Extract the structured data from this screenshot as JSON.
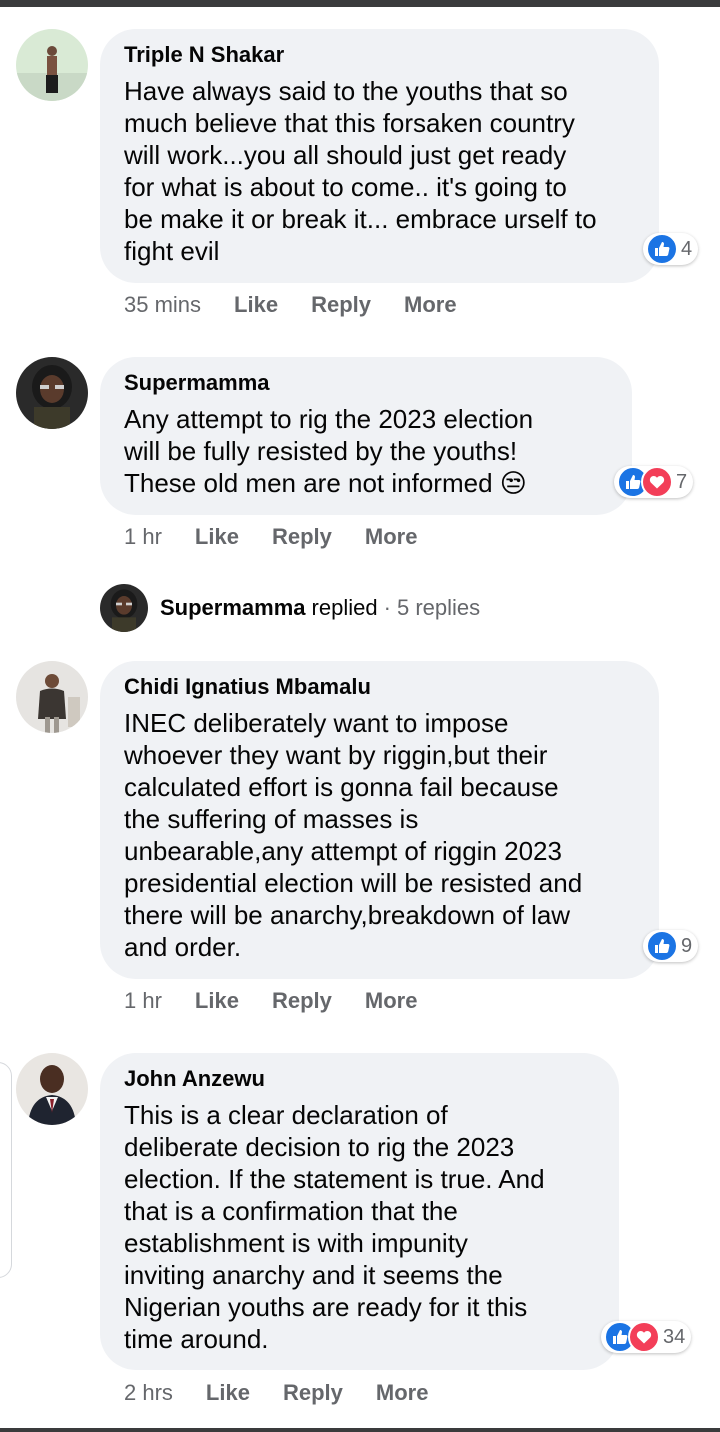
{
  "comments": [
    {
      "author": "Triple N Shakar",
      "lines": [
        "Have always said to the youths that so",
        "much believe that this forsaken country",
        "will work...you all should just get ready",
        "for what is about to come.. it's going to",
        "be make it or break it... embrace urself to",
        "fight evil"
      ],
      "reactions": {
        "count": "4",
        "types": [
          "like"
        ]
      },
      "time": "35 mins",
      "like_label": "Like",
      "reply_label": "Reply",
      "more_label": "More"
    },
    {
      "author": "Supermamma",
      "lines": [
        "Any attempt to rig the 2023 election",
        "will be fully resisted by the youths!",
        "These old men are not informed 😒"
      ],
      "reactions": {
        "count": "7",
        "types": [
          "like",
          "love"
        ]
      },
      "time": "1 hr",
      "like_label": "Like",
      "reply_label": "Reply",
      "more_label": "More"
    },
    {
      "author": "Chidi Ignatius Mbamalu",
      "lines": [
        "INEC deliberately want to impose",
        "whoever they want by riggin,but their",
        "calculated effort is gonna fail because",
        "the suffering of masses is",
        "unbearable,any attempt of riggin 2023",
        "presidential election will be resisted and",
        "there will be anarchy,breakdown of law",
        "and order."
      ],
      "reactions": {
        "count": "9",
        "types": [
          "like"
        ]
      },
      "time": "1 hr",
      "like_label": "Like",
      "reply_label": "Reply",
      "more_label": "More"
    },
    {
      "author": "John Anzewu",
      "lines": [
        "This is a clear declaration of",
        "deliberate decision to rig the 2023",
        "election. If the statement is true. And",
        "that is a confirmation that the",
        "establishment is with impunity",
        "inviting anarchy and it seems the",
        "Nigerian youths are ready for it this",
        "time around."
      ],
      "reactions": {
        "count": "34",
        "types": [
          "like",
          "love"
        ]
      },
      "time": "2 hrs",
      "like_label": "Like",
      "reply_label": "Reply",
      "more_label": "More"
    }
  ],
  "replies_row": {
    "name": "Supermamma",
    "replied": "replied",
    "count": "· 5 replies"
  },
  "colors": {
    "bubble": "#f0f2f5",
    "meta": "#65676b",
    "like": "#1b74e4",
    "love": "#f33e58"
  }
}
